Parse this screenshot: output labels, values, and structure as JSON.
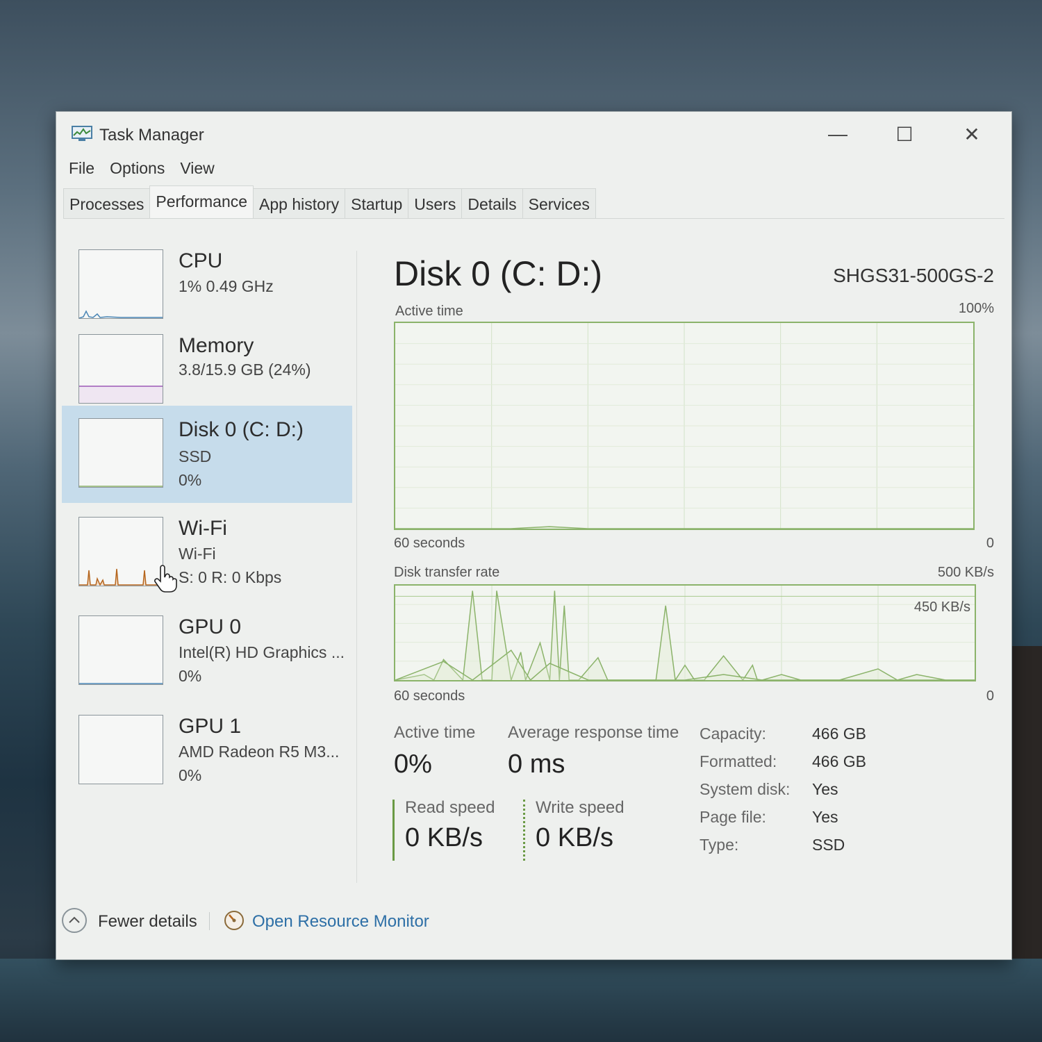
{
  "window": {
    "title": "Task Manager",
    "controls": {
      "minimize": "—",
      "maximize": "☐",
      "close": "✕"
    }
  },
  "menu": [
    "File",
    "Options",
    "View"
  ],
  "tabs": [
    "Processes",
    "Performance",
    "App history",
    "Startup",
    "Users",
    "Details",
    "Services"
  ],
  "active_tab": "Performance",
  "sidebar": {
    "items": [
      {
        "title": "CPU",
        "line1": "1%  0.49 GHz",
        "line2": ""
      },
      {
        "title": "Memory",
        "line1": "3.8/15.9 GB (24%)",
        "line2": ""
      },
      {
        "title": "Disk 0 (C: D:)",
        "line1": "SSD",
        "line2": "0%"
      },
      {
        "title": "Wi-Fi",
        "line1": "Wi-Fi",
        "line2": "S: 0  R: 0 Kbps"
      },
      {
        "title": "GPU 0",
        "line1": "Intel(R) HD Graphics ...",
        "line2": "0%"
      },
      {
        "title": "GPU 1",
        "line1": "AMD Radeon R5 M3...",
        "line2": "0%"
      }
    ],
    "selected_index": 2
  },
  "main": {
    "title": "Disk 0 (C: D:)",
    "model": "SHGS31-500GS-2",
    "active_chart": {
      "label": "Active time",
      "max_label": "100%",
      "x_left": "60 seconds",
      "x_right": "0"
    },
    "transfer_chart": {
      "label": "Disk transfer rate",
      "max_label": "500 KB/s",
      "inner_label": "450 KB/s",
      "x_left": "60 seconds",
      "x_right": "0"
    },
    "stats": {
      "active_time_label": "Active time",
      "active_time_value": "0%",
      "avg_response_label": "Average response time",
      "avg_response_value": "0 ms",
      "read_label": "Read speed",
      "read_value": "0 KB/s",
      "write_label": "Write speed",
      "write_value": "0 KB/s"
    },
    "properties": [
      {
        "key": "Capacity:",
        "value": "466 GB"
      },
      {
        "key": "Formatted:",
        "value": "466 GB"
      },
      {
        "key": "System disk:",
        "value": "Yes"
      },
      {
        "key": "Page file:",
        "value": "Yes"
      },
      {
        "key": "Type:",
        "value": "SSD"
      }
    ]
  },
  "footer": {
    "fewer_details": "Fewer details",
    "open_resource_monitor": "Open Resource Monitor"
  },
  "colors": {
    "disk_green": "#8bb36a",
    "selected_bg": "#c6dceb",
    "link_blue": "#2d6fa6",
    "wifi_orange": "#b5651d"
  },
  "chart_data": [
    {
      "type": "line",
      "title": "Active time",
      "x_range_seconds": [
        60,
        0
      ],
      "ylim": [
        0,
        100
      ],
      "unit": "%",
      "x": [
        60,
        48,
        44,
        40,
        32,
        24,
        16,
        8,
        0
      ],
      "values": [
        0,
        0,
        1,
        0,
        0,
        0,
        0,
        0,
        0
      ]
    },
    {
      "type": "line",
      "title": "Disk transfer rate",
      "x_range_seconds": [
        60,
        0
      ],
      "ylim": [
        0,
        500
      ],
      "unit": "KB/s",
      "series": [
        {
          "x": [
            60,
            57,
            56,
            55,
            53,
            52,
            51,
            50,
            49.5,
            48,
            47,
            46.5,
            45,
            44,
            43.5,
            43,
            42.5,
            42,
            41,
            39,
            38,
            37,
            35,
            33,
            32,
            31,
            30,
            29,
            28,
            26,
            24,
            23,
            22.5,
            22,
            20,
            18,
            16,
            14,
            10,
            8,
            6,
            3,
            0
          ],
          "values": [
            0,
            30,
            0,
            110,
            0,
            480,
            0,
            0,
            480,
            0,
            150,
            0,
            200,
            0,
            480,
            0,
            400,
            0,
            0,
            120,
            0,
            0,
            0,
            0,
            400,
            0,
            80,
            0,
            0,
            130,
            0,
            80,
            0,
            0,
            30,
            0,
            0,
            0,
            60,
            0,
            30,
            0,
            0
          ]
        },
        {
          "x": [
            60,
            55,
            52,
            48,
            46,
            44,
            40,
            36,
            30,
            26,
            22,
            16,
            10,
            6,
            0
          ],
          "values": [
            0,
            100,
            0,
            160,
            0,
            90,
            0,
            0,
            0,
            30,
            0,
            0,
            0,
            0,
            0
          ]
        }
      ]
    }
  ]
}
